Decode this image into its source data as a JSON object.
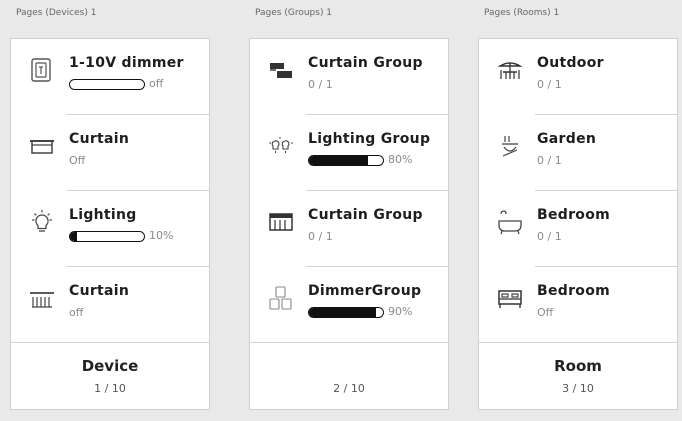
{
  "columns": [
    {
      "title": "Pages (Devices) 1",
      "footer_label": "Device",
      "footer_page": "1 / 10",
      "tiles": [
        {
          "name": "1-10V dimmer",
          "status": "off",
          "level": 0,
          "icon": "dimmer-icon"
        },
        {
          "name": "Curtain",
          "status": "Off",
          "icon": "curtain-icon"
        },
        {
          "name": "Lighting",
          "status": "10%",
          "level": 0.1,
          "icon": "bulb-icon"
        },
        {
          "name": "Curtain",
          "status": "off",
          "icon": "blind-icon"
        }
      ]
    },
    {
      "title": "Pages (Groups) 1",
      "footer_label": "",
      "footer_page": "2 / 10",
      "tiles": [
        {
          "name": "Curtain Group",
          "status": "0 / 1",
          "icon": "curtain-group-icon"
        },
        {
          "name": "Lighting Group",
          "status": "80%",
          "level": 0.8,
          "icon": "lighting-group-icon"
        },
        {
          "name": "Curtain Group",
          "status": "0 / 1",
          "icon": "curtain-group-icon"
        },
        {
          "name": "DimmerGroup",
          "status": "90%",
          "level": 0.9,
          "icon": "dimmer-group-icon"
        }
      ]
    },
    {
      "title": "Pages (Rooms) 1",
      "footer_label": "Room",
      "footer_page": "3 / 10",
      "tiles": [
        {
          "name": "Outdoor",
          "status": "0 / 1",
          "icon": "outdoor-table-icon"
        },
        {
          "name": "Garden",
          "status": "0 / 1",
          "icon": "garden-icon"
        },
        {
          "name": "Bedroom",
          "status": "0 / 1",
          "icon": "bathtub-icon"
        },
        {
          "name": "Bedroom",
          "status": "Off",
          "icon": "bed-icon"
        }
      ]
    }
  ]
}
